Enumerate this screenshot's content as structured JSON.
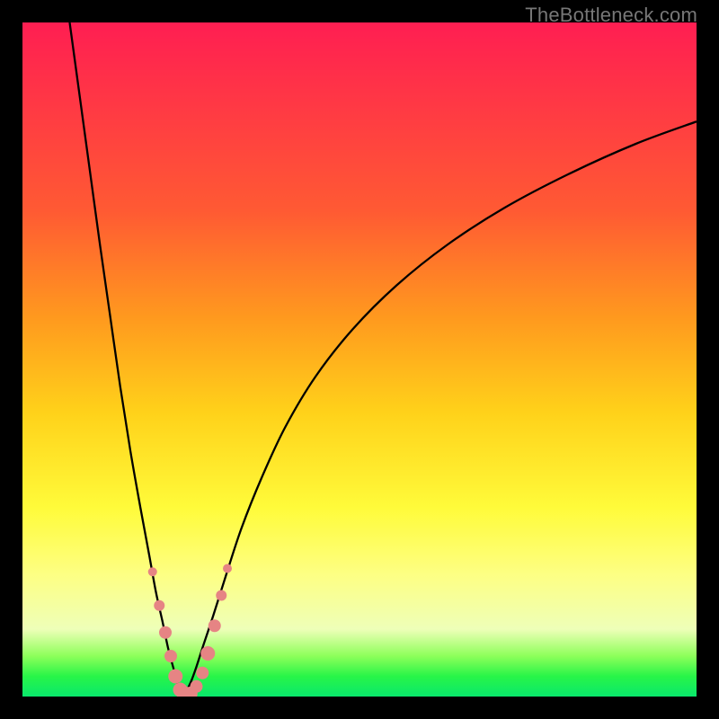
{
  "watermark": "TheBottleneck.com",
  "colors": {
    "frame": "#000000",
    "curve": "#000000",
    "marker_fill": "#e68484",
    "marker_stroke": "#c05858",
    "gradient_stops": [
      "#ff1e52",
      "#ff2b4b",
      "#ff5a33",
      "#ff9a1e",
      "#ffd21a",
      "#fffb3a",
      "#fdff84",
      "#eeffb8",
      "#8dff5a",
      "#28f548",
      "#09e86c"
    ]
  },
  "chart_data": {
    "type": "line",
    "title": "",
    "xlabel": "",
    "ylabel": "",
    "xlim": [
      0,
      100
    ],
    "ylim": [
      0,
      100
    ],
    "note": "Axis values are in percent of the plot area. y=0 is bottom. No tick labels are drawn in the source image; the background color encodes quality (green=good, red=bad).",
    "curves": [
      {
        "name": "left-branch",
        "x": [
          7.0,
          8.5,
          10.0,
          11.5,
          13.0,
          14.5,
          16.0,
          17.5,
          18.8,
          19.8,
          20.8,
          21.6,
          22.4,
          23.0,
          23.5,
          23.8
        ],
        "y": [
          100.0,
          89.0,
          78.0,
          67.0,
          56.5,
          46.0,
          36.5,
          28.0,
          21.0,
          15.5,
          11.0,
          7.2,
          4.2,
          2.0,
          0.8,
          0.0
        ]
      },
      {
        "name": "right-branch",
        "x": [
          23.8,
          24.3,
          25.0,
          25.8,
          26.8,
          28.3,
          30.2,
          32.5,
          35.5,
          39.0,
          43.5,
          49.0,
          55.5,
          63.0,
          71.5,
          81.0,
          91.0,
          100.0
        ],
        "y": [
          0.0,
          0.8,
          2.2,
          4.4,
          7.5,
          12.0,
          18.0,
          25.0,
          32.5,
          40.0,
          47.5,
          54.5,
          61.0,
          67.0,
          72.5,
          77.5,
          82.0,
          85.3
        ]
      }
    ],
    "markers": {
      "name": "highlight-dots",
      "fill": "#e68484",
      "r_range": [
        4,
        9
      ],
      "points": [
        {
          "x": 19.3,
          "y": 18.5,
          "r": 5
        },
        {
          "x": 20.3,
          "y": 13.5,
          "r": 6
        },
        {
          "x": 21.2,
          "y": 9.5,
          "r": 7
        },
        {
          "x": 22.0,
          "y": 6.0,
          "r": 7
        },
        {
          "x": 22.7,
          "y": 3.0,
          "r": 8
        },
        {
          "x": 23.4,
          "y": 1.0,
          "r": 8
        },
        {
          "x": 24.1,
          "y": 0.3,
          "r": 9
        },
        {
          "x": 24.9,
          "y": 0.4,
          "r": 8
        },
        {
          "x": 25.8,
          "y": 1.5,
          "r": 7
        },
        {
          "x": 26.7,
          "y": 3.5,
          "r": 7
        },
        {
          "x": 27.5,
          "y": 6.4,
          "r": 8
        },
        {
          "x": 28.5,
          "y": 10.5,
          "r": 7
        },
        {
          "x": 29.5,
          "y": 15.0,
          "r": 6
        },
        {
          "x": 30.4,
          "y": 19.0,
          "r": 5
        }
      ]
    }
  }
}
